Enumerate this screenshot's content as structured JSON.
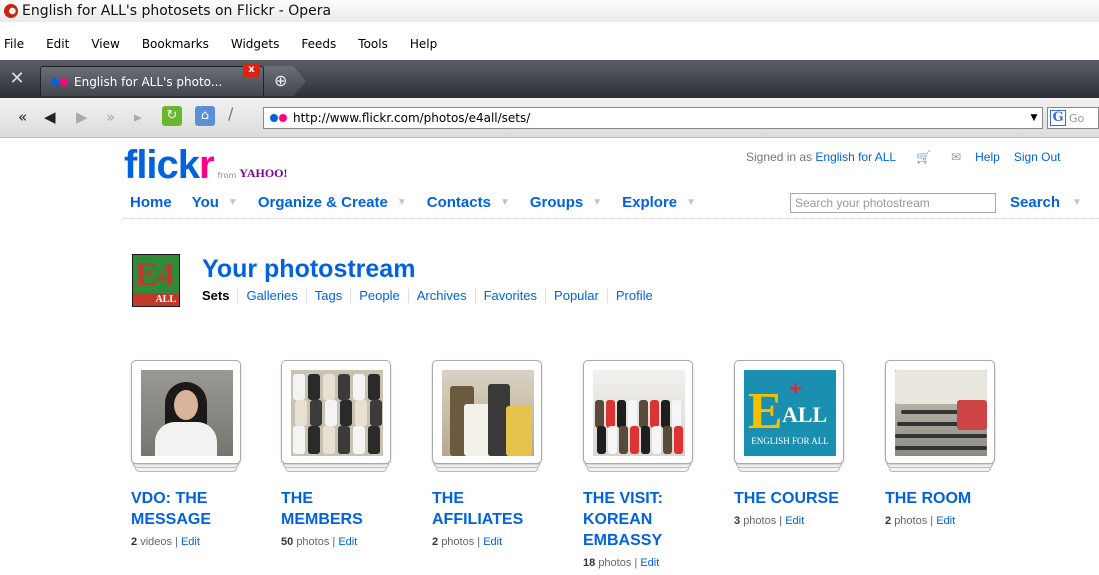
{
  "window": {
    "title": "English for ALL's photosets on Flickr - Opera"
  },
  "menu": [
    "File",
    "Edit",
    "View",
    "Bookmarks",
    "Widgets",
    "Feeds",
    "Tools",
    "Help"
  ],
  "tab": {
    "label": "English for ALL's photo...",
    "close": "x"
  },
  "address": {
    "url": "http://www.flickr.com/photos/e4all/sets/",
    "search_placeholder": "Go"
  },
  "flickr": {
    "logo_flick": "flick",
    "logo_r": "r",
    "from": "from",
    "yahoo": "YAHOO!",
    "signed_in_prefix": "Signed in as",
    "user": "English for ALL",
    "help": "Help",
    "signout": "Sign Out",
    "nav": [
      "Home",
      "You",
      "Organize & Create",
      "Contacts",
      "Groups",
      "Explore"
    ],
    "search_placeholder": "Search your photostream",
    "search_button": "Search"
  },
  "photostream": {
    "buddy_text": "E4",
    "buddy_sub": "ALL",
    "title": "Your photostream",
    "subnav": [
      "Sets",
      "Galleries",
      "Tags",
      "People",
      "Archives",
      "Favorites",
      "Popular",
      "Profile"
    ]
  },
  "sets": [
    {
      "title": "VDO: THE MESSAGE",
      "lines": [
        "VDO: THE",
        "MESSAGE"
      ],
      "count": "2",
      "unit": "videos",
      "edit": "Edit"
    },
    {
      "title": "THE MEMBERS",
      "lines": [
        "THE",
        "MEMBERS"
      ],
      "count": "50",
      "unit": "photos",
      "edit": "Edit"
    },
    {
      "title": "THE AFFILIATES",
      "lines": [
        "THE",
        "AFFILIATES"
      ],
      "count": "2",
      "unit": "photos",
      "edit": "Edit"
    },
    {
      "title": "THE VISIT: KOREAN EMBASSY",
      "lines": [
        "THE VISIT:",
        "KOREAN",
        "EMBASSY"
      ],
      "count": "18",
      "unit": "photos",
      "edit": "Edit"
    },
    {
      "title": "THE COURSE",
      "lines": [
        "THE COURSE"
      ],
      "count": "3",
      "unit": "photos",
      "edit": "Edit"
    },
    {
      "title": "THE ROOM",
      "lines": [
        "THE ROOM"
      ],
      "count": "2",
      "unit": "photos",
      "edit": "Edit"
    }
  ],
  "course_cover": {
    "big": "E",
    "all": "ALL",
    "sub": "ENGLISH FOR ALL"
  },
  "colors": {
    "flickr_blue": "#0063dc",
    "flickr_pink": "#ff0084",
    "yahoo_purple": "#7b0099"
  }
}
